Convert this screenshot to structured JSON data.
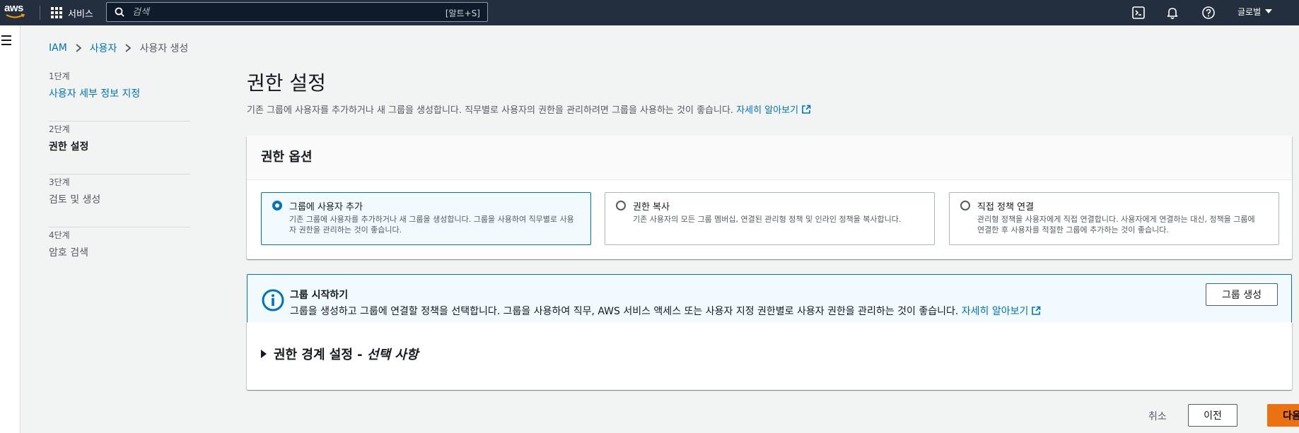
{
  "topnav": {
    "logo": "aws",
    "services_label": "서비스",
    "search_placeholder": "검색",
    "search_shortcut": "[알트+S]",
    "icons": [
      "cloudshell-icon",
      "notifications-icon",
      "help-icon"
    ],
    "region_label": "글로벌"
  },
  "breadcrumb": {
    "items": [
      "IAM",
      "사용자",
      "사용자 생성"
    ]
  },
  "steps": [
    {
      "num": "1단계",
      "name": "사용자 세부 정보 지정"
    },
    {
      "num": "2단계",
      "name": "권한 설정"
    },
    {
      "num": "3단계",
      "name": "검토 및 생성"
    },
    {
      "num": "4단계",
      "name": "암호 검색"
    }
  ],
  "page": {
    "title": "권한 설정",
    "description": "기존 그룹에 사용자를 추가하거나 새 그룹을 생성합니다. 직무별로 사용자의 권한을 관리하려면 그룹을 사용하는 것이 좋습니다.",
    "learn_more": "자세히 알아보기"
  },
  "options_panel": {
    "header": "권한 옵션",
    "options": [
      {
        "title": "그룹에 사용자 추가",
        "desc": "기존 그룹에 사용자를 추가하거나 새 그룹을 생성합니다. 그룹을 사용하여 직무별로 사용자 권한을 관리하는 것이 좋습니다.",
        "selected": true
      },
      {
        "title": "권한 복사",
        "desc": "기존 사용자의 모든 그룹 멤버십, 연결된 관리형 정책 및 인라인 정책을 복사합니다.",
        "selected": false
      },
      {
        "title": "직접 정책 연결",
        "desc": "관리형 정책을 사용자에게 직접 연결합니다. 사용자에게 연결하는 대신, 정책을 그룹에 연결한 후 사용자를 적절한 그룹에 추가하는 것이 좋습니다.",
        "selected": false
      }
    ]
  },
  "alert": {
    "title": "그룹 시작하기",
    "desc": "그룹을 생성하고 그룹에 연결할 정책을 선택합니다. 그룹을 사용하여 직무, AWS 서비스 액세스 또는 사용자 지정 권한별로 사용자 권한을 관리하는 것이 좋습니다.",
    "learn_more": "자세히 알아보기",
    "button": "그룹 생성"
  },
  "boundary": {
    "title": "권한 경계 설정 - ",
    "optional": "선택 사항"
  },
  "footer": {
    "cancel": "취소",
    "previous": "이전",
    "next": "다음"
  },
  "colors": {
    "nav_bg": "#232f3e",
    "link": "#0073bb",
    "primary_button": "#ec7211",
    "alert_bg": "#f1faff"
  }
}
